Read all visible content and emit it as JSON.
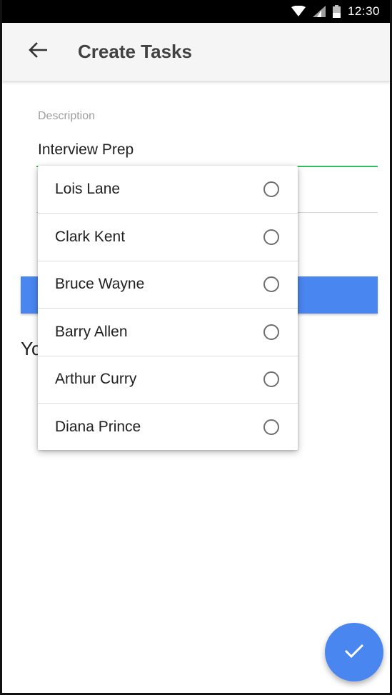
{
  "status_bar": {
    "time": "12:30",
    "wifi_icon": "wifi-icon",
    "signal_icon": "signal-icon",
    "battery_icon": "battery-icon"
  },
  "app_bar": {
    "back_icon": "arrow-back-icon",
    "title": "Create Tasks"
  },
  "form": {
    "description_label": "Description",
    "description_value": "Interview Prep",
    "primary_button_label": "",
    "partial_text": "Yo"
  },
  "dropdown": {
    "options": [
      {
        "label": "Lois Lane",
        "selected": false
      },
      {
        "label": "Clark Kent",
        "selected": false
      },
      {
        "label": "Bruce Wayne",
        "selected": false
      },
      {
        "label": "Barry Allen",
        "selected": false
      },
      {
        "label": "Arthur Curry",
        "selected": false
      },
      {
        "label": "Diana Prince",
        "selected": false
      }
    ]
  },
  "fab": {
    "icon": "check-icon"
  },
  "colors": {
    "accent": "#4a86f0",
    "focus_underline": "#2ec05a",
    "app_bar_bg": "#f5f5f5",
    "status_bar_bg": "#000000"
  }
}
